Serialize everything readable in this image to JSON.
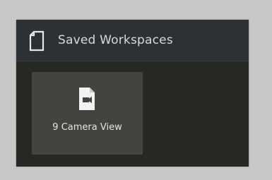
{
  "panel": {
    "title": "Saved Workspaces",
    "title_icon": "document-icon"
  },
  "workspaces": [
    {
      "label": "9 Camera View",
      "icon": "video-file-icon"
    }
  ],
  "colors": {
    "page_background": "#c7c7c7",
    "panel_background": "#252823",
    "header_background": "#2c3136",
    "tile_background": "#41443f",
    "text": "#d9d9d9"
  }
}
